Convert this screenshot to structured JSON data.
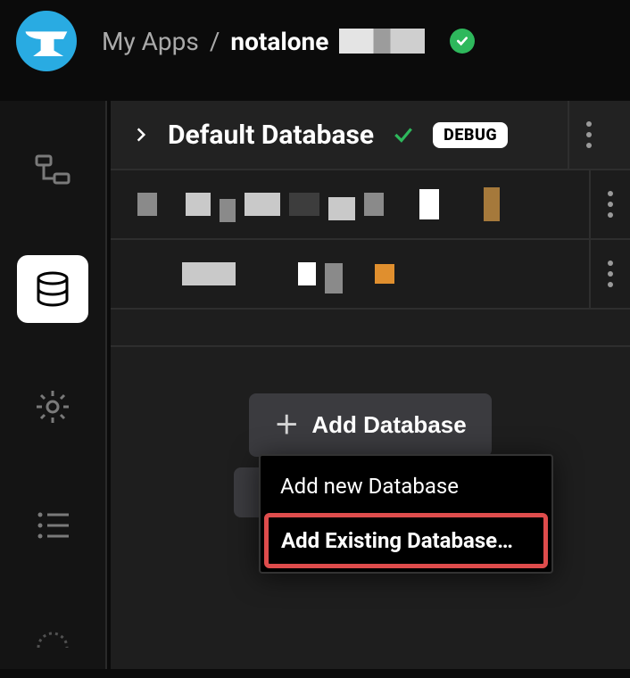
{
  "header": {
    "breadcrumb_root": "My Apps",
    "breadcrumb_current": "notalone",
    "status": "ok"
  },
  "sidebar": {
    "items": [
      "tree",
      "database",
      "settings",
      "list",
      "gauge"
    ],
    "active": "database"
  },
  "database": {
    "title": "Default Database",
    "debug_label": "DEBUG"
  },
  "actions": {
    "add_db_label": "Add Database",
    "menu": {
      "add_new": "Add new Database",
      "add_existing": "Add Existing Database…"
    }
  }
}
